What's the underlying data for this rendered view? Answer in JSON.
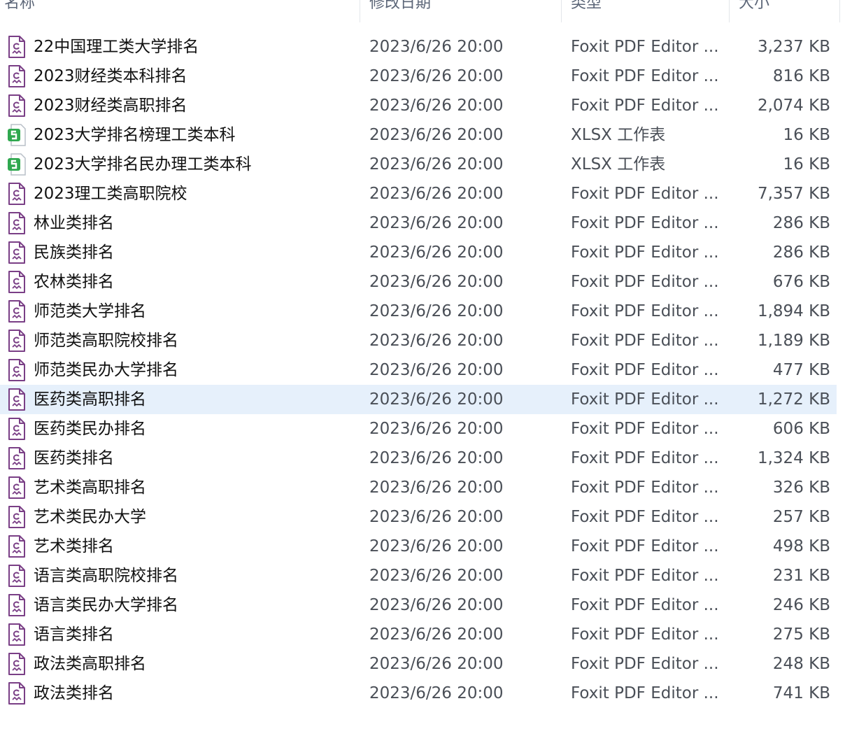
{
  "columns": {
    "name": "名称",
    "modified": "修改日期",
    "type": "类型",
    "size": "大小"
  },
  "files": [
    {
      "name": "22中国理工类大学排名",
      "modified": "2023/6/26 20:00",
      "type": "Foxit PDF Editor ...",
      "size": "3,237 KB",
      "icon": "pdf-file-icon"
    },
    {
      "name": "2023财经类本科排名",
      "modified": "2023/6/26 20:00",
      "type": "Foxit PDF Editor ...",
      "size": "816 KB",
      "icon": "pdf-file-icon"
    },
    {
      "name": "2023财经类高职排名",
      "modified": "2023/6/26 20:00",
      "type": "Foxit PDF Editor ...",
      "size": "2,074 KB",
      "icon": "pdf-file-icon"
    },
    {
      "name": "2023大学排名榜理工类本科",
      "modified": "2023/6/26 20:00",
      "type": "XLSX 工作表",
      "size": "16 KB",
      "icon": "xlsx-file-icon"
    },
    {
      "name": "2023大学排名民办理工类本科",
      "modified": "2023/6/26 20:00",
      "type": "XLSX 工作表",
      "size": "16 KB",
      "icon": "xlsx-file-icon"
    },
    {
      "name": "2023理工类高职院校",
      "modified": "2023/6/26 20:00",
      "type": "Foxit PDF Editor ...",
      "size": "7,357 KB",
      "icon": "pdf-file-icon"
    },
    {
      "name": "林业类排名",
      "modified": "2023/6/26 20:00",
      "type": "Foxit PDF Editor ...",
      "size": "286 KB",
      "icon": "pdf-file-icon"
    },
    {
      "name": "民族类排名",
      "modified": "2023/6/26 20:00",
      "type": "Foxit PDF Editor ...",
      "size": "286 KB",
      "icon": "pdf-file-icon"
    },
    {
      "name": "农林类排名",
      "modified": "2023/6/26 20:00",
      "type": "Foxit PDF Editor ...",
      "size": "676 KB",
      "icon": "pdf-file-icon"
    },
    {
      "name": "师范类大学排名",
      "modified": "2023/6/26 20:00",
      "type": "Foxit PDF Editor ...",
      "size": "1,894 KB",
      "icon": "pdf-file-icon"
    },
    {
      "name": "师范类高职院校排名",
      "modified": "2023/6/26 20:00",
      "type": "Foxit PDF Editor ...",
      "size": "1,189 KB",
      "icon": "pdf-file-icon"
    },
    {
      "name": "师范类民办大学排名",
      "modified": "2023/6/26 20:00",
      "type": "Foxit PDF Editor ...",
      "size": "477 KB",
      "icon": "pdf-file-icon"
    },
    {
      "name": "医药类高职排名",
      "modified": "2023/6/26 20:00",
      "type": "Foxit PDF Editor ...",
      "size": "1,272 KB",
      "icon": "pdf-file-icon",
      "selected": true
    },
    {
      "name": "医药类民办排名",
      "modified": "2023/6/26 20:00",
      "type": "Foxit PDF Editor ...",
      "size": "606 KB",
      "icon": "pdf-file-icon"
    },
    {
      "name": "医药类排名",
      "modified": "2023/6/26 20:00",
      "type": "Foxit PDF Editor ...",
      "size": "1,324 KB",
      "icon": "pdf-file-icon"
    },
    {
      "name": "艺术类高职排名",
      "modified": "2023/6/26 20:00",
      "type": "Foxit PDF Editor ...",
      "size": "326 KB",
      "icon": "pdf-file-icon"
    },
    {
      "name": "艺术类民办大学",
      "modified": "2023/6/26 20:00",
      "type": "Foxit PDF Editor ...",
      "size": "257 KB",
      "icon": "pdf-file-icon"
    },
    {
      "name": "艺术类排名",
      "modified": "2023/6/26 20:00",
      "type": "Foxit PDF Editor ...",
      "size": "498 KB",
      "icon": "pdf-file-icon"
    },
    {
      "name": "语言类高职院校排名",
      "modified": "2023/6/26 20:00",
      "type": "Foxit PDF Editor ...",
      "size": "231 KB",
      "icon": "pdf-file-icon"
    },
    {
      "name": "语言类民办大学排名",
      "modified": "2023/6/26 20:00",
      "type": "Foxit PDF Editor ...",
      "size": "246 KB",
      "icon": "pdf-file-icon"
    },
    {
      "name": "语言类排名",
      "modified": "2023/6/26 20:00",
      "type": "Foxit PDF Editor ...",
      "size": "275 KB",
      "icon": "pdf-file-icon"
    },
    {
      "name": "政法类高职排名",
      "modified": "2023/6/26 20:00",
      "type": "Foxit PDF Editor ...",
      "size": "248 KB",
      "icon": "pdf-file-icon"
    },
    {
      "name": "政法类排名",
      "modified": "2023/6/26 20:00",
      "type": "Foxit PDF Editor ...",
      "size": "741 KB",
      "icon": "pdf-file-icon"
    }
  ],
  "colors": {
    "pdf_icon": "#7a3f86",
    "xlsx_icon": "#2fa84f",
    "selection": "#e6f0fb"
  }
}
